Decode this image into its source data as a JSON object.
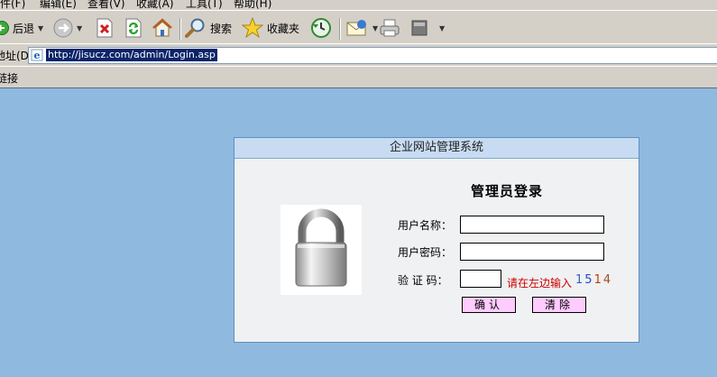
{
  "menu": [
    "文件(F)",
    "编辑(E)",
    "查看(V)",
    "收藏(A)",
    "工具(T)",
    "帮助(H)"
  ],
  "toolbar": {
    "back_label": "后退",
    "search_label": "搜索",
    "favorites_label": "收藏夹"
  },
  "address": {
    "label": "地址(D)",
    "url": "http://jisucz.com/admin/Login.asp"
  },
  "links_label": "链接",
  "panel": {
    "title": "企业网站管理系统",
    "heading": "管理员登录",
    "username_label": "用户名称：",
    "password_label": "用户密码：",
    "captcha_label": "验 证 码：",
    "captcha_hint": "请在左边输入",
    "captcha_code": [
      "1",
      "5",
      "1",
      "4"
    ],
    "confirm_button": "确认",
    "clear_button": "清除"
  },
  "icons": {
    "back": "back-arrow-icon",
    "forward": "forward-arrow-icon",
    "stop": "stop-icon",
    "refresh": "refresh-icon",
    "home": "home-icon",
    "search": "search-icon",
    "favorites": "star-icon",
    "history": "history-icon",
    "mail": "mail-icon",
    "print": "printer-icon",
    "edit": "edit-icon",
    "page": "ie-page-icon",
    "lock": "padlock-icon"
  }
}
